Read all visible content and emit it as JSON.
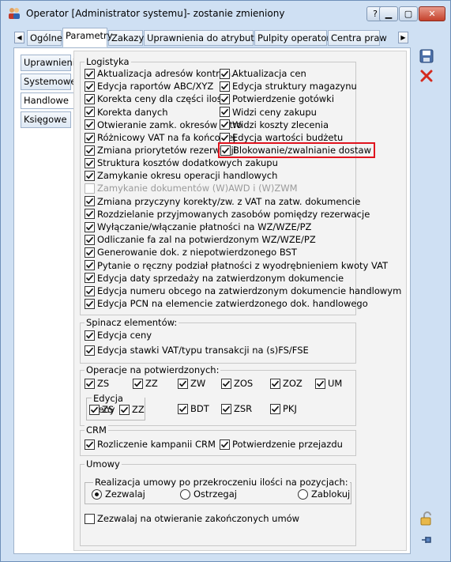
{
  "window": {
    "title": "Operator [Administrator systemu]- zostanie zmieniony",
    "buttons": [
      "help-icon",
      "minimize-icon",
      "maximize-icon",
      "close-icon"
    ]
  },
  "tabs": [
    "Ogólne",
    "Parametry",
    "Zakazy",
    "Uprawnienia do atrybutów",
    "Pulpity operatora",
    "Centra praw"
  ],
  "active_tab": "Parametry",
  "side_tabs": [
    "Uprawnienia",
    "Systemowe",
    "Handlowe",
    "Księgowe"
  ],
  "active_side_tab": "Handlowe",
  "logistyka": {
    "label": "Logistyka",
    "left": [
      {
        "label": "Aktualizacja adresów kontrah.",
        "checked": true
      },
      {
        "label": "Edycja raportów ABC/XYZ",
        "checked": true
      },
      {
        "label": "Korekta ceny dla części ilości",
        "checked": true
      },
      {
        "label": "Korekta danych",
        "checked": true
      },
      {
        "label": "Otwieranie zamk. okresów retro",
        "checked": true
      },
      {
        "label": "Różnicowy VAT na fa końcowej",
        "checked": true
      },
      {
        "label": "Zmiana priorytetów rezerwacji",
        "checked": true
      }
    ],
    "right": [
      {
        "label": "Aktualizacja cen",
        "checked": true
      },
      {
        "label": "Edycja struktury magazynu",
        "checked": true
      },
      {
        "label": "Potwierdzenie gotówki",
        "checked": true
      },
      {
        "label": "Widzi ceny zakupu",
        "checked": true
      },
      {
        "label": "Widzi koszty zlecenia",
        "checked": true
      },
      {
        "label": "Edycja wartości budżetu",
        "checked": true
      },
      {
        "label": "Blokowanie/zwalnianie dostaw",
        "checked": true
      }
    ],
    "full": [
      {
        "label": "Struktura kosztów dodatkowych zakupu",
        "checked": true,
        "disabled": false
      },
      {
        "label": "Zamykanie okresu operacji handlowych",
        "checked": true,
        "disabled": false
      },
      {
        "label": "Zamykanie dokumentów (W)AWD i (W)ZWM",
        "checked": false,
        "disabled": true
      },
      {
        "label": "Zmiana przyczyny korekty/zw. z VAT na zatw. dokumencie",
        "checked": true,
        "disabled": false
      },
      {
        "label": "Rozdzielanie przyjmowanych zasobów pomiędzy rezerwacje",
        "checked": true,
        "disabled": false
      },
      {
        "label": "Wyłączanie/włączanie płatności na WZ/WZE/PZ",
        "checked": true,
        "disabled": false
      },
      {
        "label": "Odliczanie fa zal na potwierdzonym WZ/WZE/PZ",
        "checked": true,
        "disabled": false
      },
      {
        "label": "Generowanie dok. z niepotwierdzonego BST",
        "checked": true,
        "disabled": false
      },
      {
        "label": "Pytanie o ręczny podział płatności z wyodrębnieniem kwoty VAT",
        "checked": true,
        "disabled": false
      },
      {
        "label": "Edycja daty sprzedaży na zatwierdzonym dokumencie",
        "checked": true,
        "disabled": false
      },
      {
        "label": "Edycja numeru obcego na zatwierdzonym dokumencie handlowym",
        "checked": true,
        "disabled": false
      },
      {
        "label": "Edycja PCN na elemencie zatwierdzonego dok. handlowego",
        "checked": true,
        "disabled": false
      }
    ]
  },
  "spinacz": {
    "label": "Spinacz elementów:",
    "items": [
      {
        "label": "Edycja ceny",
        "checked": true
      },
      {
        "label": "Edycja stawki VAT/typu transakcji na (s)FS/FSE",
        "checked": true
      }
    ]
  },
  "operacje": {
    "label": "Operacje na potwierdzonych:",
    "row1": [
      {
        "label": "ZS",
        "checked": true
      },
      {
        "label": "ZZ",
        "checked": true
      },
      {
        "label": "ZW",
        "checked": true
      },
      {
        "label": "ZOS",
        "checked": true
      },
      {
        "label": "ZOZ",
        "checked": true
      },
      {
        "label": "UM",
        "checked": true
      }
    ],
    "edycja_ceny_label": "Edycja ceny",
    "edycja_ceny": [
      {
        "label": "ZS",
        "checked": true
      },
      {
        "label": "ZZ",
        "checked": true
      }
    ],
    "row2": [
      {
        "label": "BDT",
        "checked": true
      },
      {
        "label": "ZSR",
        "checked": true
      },
      {
        "label": "PKJ",
        "checked": true
      }
    ]
  },
  "crm": {
    "label": "CRM",
    "items": [
      {
        "label": "Rozliczenie kampanii CRM",
        "checked": true
      },
      {
        "label": "Potwierdzenie przejazdu",
        "checked": true
      }
    ]
  },
  "umowy": {
    "label": "Umowy",
    "realizacja_label": "Realizacja umowy po przekroczeniu ilości na pozycjach:",
    "radios": [
      {
        "label": "Zezwalaj",
        "selected": true
      },
      {
        "label": "Ostrzegaj",
        "selected": false
      },
      {
        "label": "Zablokuj",
        "selected": false
      }
    ],
    "zezwalaj_zakonczonych": {
      "label": "Zezwalaj na otwieranie zakończonych umów",
      "checked": false
    }
  },
  "side_buttons": [
    "save-icon",
    "delete-icon",
    "lock-icon",
    "pin-icon"
  ],
  "colors": {
    "highlight": "#e0141e",
    "accent": "#cfe0f3"
  }
}
